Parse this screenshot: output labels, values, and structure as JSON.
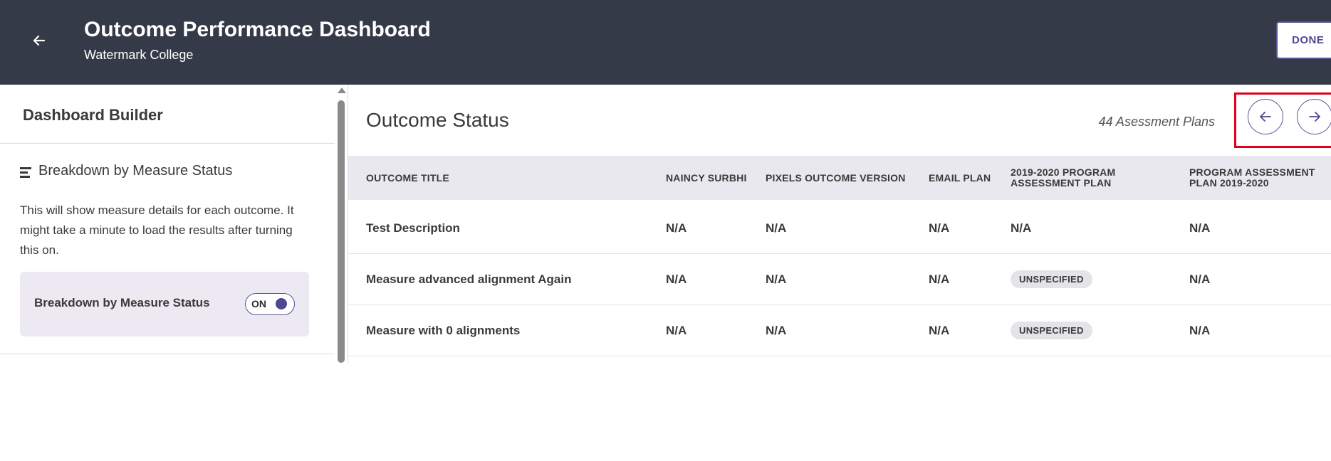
{
  "header": {
    "title": "Outcome Performance Dashboard",
    "subtitle": "Watermark College",
    "done_label": "DONE"
  },
  "sidebar": {
    "title": "Dashboard Builder",
    "section_title": "Breakdown by Measure Status",
    "description": "This will show measure details for each outcome. It might take a minute to load the results after turning this on.",
    "toggle": {
      "label": "Breakdown by Measure Status",
      "state_text": "ON"
    }
  },
  "main": {
    "title": "Outcome Status",
    "plans_count": "44 Asessment Plans",
    "columns": [
      "OUTCOME TITLE",
      "NAINCY SURBHI",
      "PIXELS OUTCOME VERSION",
      "EMAIL PLAN",
      "2019-2020 PROGRAM ASSESSMENT PLAN",
      "PROGRAM ASSESSMENT PLAN 2019-2020"
    ],
    "rows": [
      {
        "title": "Test Description",
        "a": "N/A",
        "b": "N/A",
        "c": "N/A",
        "d": "N/A",
        "e": "N/A"
      },
      {
        "title": "Measure advanced alignment Again",
        "a": "N/A",
        "b": "N/A",
        "c": "N/A",
        "d": "UNSPECIFIED",
        "e": "N/A"
      },
      {
        "title": "Measure with 0 alignments",
        "a": "N/A",
        "b": "N/A",
        "c": "N/A",
        "d": "UNSPECIFIED",
        "e": "N/A"
      }
    ]
  },
  "colors": {
    "header_bg": "#353a48",
    "accent": "#4f4790",
    "highlight_border": "#e0001b",
    "table_header_bg": "#e9e8ee",
    "toggle_card_bg": "#ece9f3"
  },
  "icons": {
    "back": "arrow-left-icon",
    "prev": "arrow-left-icon",
    "next": "arrow-right-icon",
    "section": "bar-chart-horizontal-icon"
  }
}
